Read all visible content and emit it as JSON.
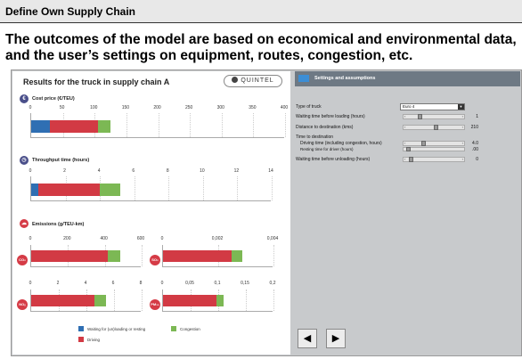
{
  "slide": {
    "title": "Define Own Supply Chain",
    "headline": "The outcomes of the model are based on economical and environmental data, and the user’s settings on equipment, routes, congestion, etc."
  },
  "results": {
    "title": "Results for the truck in supply chain A",
    "logo": "QUINTEL"
  },
  "colors": {
    "waiting": "#2f6fb3",
    "driving": "#d23a44",
    "congestion": "#7cb854",
    "icon_cost": "#4a4f8a",
    "icon_time": "#4a4f8a",
    "icon_emission": "#d53b46"
  },
  "sections": {
    "cost": {
      "label": "Cost price (€/TEU)",
      "icon": "€"
    },
    "time": {
      "label": "Throughput time (hours)",
      "icon": "◷"
    },
    "emissions": {
      "label": "Emissions (g/TEU-km)",
      "icon": "☁"
    }
  },
  "mini_icons": {
    "co2": "CO₂",
    "so2": "SO₂",
    "nox": "NOₓ",
    "pm": "PM₁₀"
  },
  "chart_data": [
    {
      "type": "bar",
      "name_key": "cost",
      "ticks": [
        "0",
        "50",
        "100",
        "150",
        "200",
        "250",
        "300",
        "350",
        "400"
      ],
      "xlim": [
        0,
        400
      ],
      "series": [
        {
          "name": "Waiting time (un)loading or resting",
          "value": 30
        },
        {
          "name": "Driving",
          "value": 75
        },
        {
          "name": "Congestion",
          "value": 20
        }
      ]
    },
    {
      "type": "bar",
      "name_key": "time",
      "ticks": [
        "0",
        "2",
        "4",
        "6",
        "8",
        "10",
        "12",
        "14"
      ],
      "xlim": [
        0,
        14
      ],
      "series": [
        {
          "name": "Waiting time (un)loading or resting",
          "value": 0.4
        },
        {
          "name": "Driving",
          "value": 3.6
        },
        {
          "name": "Congestion",
          "value": 1.2
        }
      ]
    },
    {
      "type": "bar",
      "name_key": "co2",
      "ticks": [
        "0",
        "200",
        "400",
        "600"
      ],
      "xlim": [
        0,
        600
      ],
      "series": [
        {
          "name": "Driving",
          "value": 415
        },
        {
          "name": "Congestion",
          "value": 70
        }
      ]
    },
    {
      "type": "bar",
      "name_key": "so2",
      "ticks": [
        "0",
        "0,002",
        "0,004"
      ],
      "xlim": [
        0,
        0.005
      ],
      "series": [
        {
          "name": "Driving",
          "value": 0.0031
        },
        {
          "name": "Congestion",
          "value": 0.0005
        }
      ]
    },
    {
      "type": "bar",
      "name_key": "nox",
      "ticks": [
        "0",
        "2",
        "4",
        "6",
        "8"
      ],
      "xlim": [
        0,
        8
      ],
      "series": [
        {
          "name": "Driving",
          "value": 4.6
        },
        {
          "name": "Congestion",
          "value": 0.8
        }
      ]
    },
    {
      "type": "bar",
      "name_key": "pm",
      "ticks": [
        "0",
        "0,05",
        "0,1",
        "0,15",
        "0,2"
      ],
      "xlim": [
        0,
        0.2
      ],
      "series": [
        {
          "name": "Driving",
          "value": 0.097
        },
        {
          "name": "Congestion",
          "value": 0.013
        }
      ]
    }
  ],
  "legend": {
    "waiting": "Waiting for (un)loading or resting",
    "driving": "Driving",
    "congestion": "Congestion"
  },
  "settings": {
    "title": "Settings and assumptions",
    "truck_type_label": "Type of truck",
    "truck_type_value": "Euro 4",
    "waiting_before_loading_label": "Waiting time before loading (hours)",
    "waiting_before_loading_value": "1",
    "distance_label": "Distance to destination (kms)",
    "distance_value": "210",
    "time_to_destination_label": "Time to destination",
    "driving_time_label": "Driving time (including congestion, hours)",
    "driving_time_value": "4.0",
    "resting_time_label": "Resting time for driver (hours)",
    "resting_time_value": ".00",
    "waiting_before_unloading_label": "Waiting time before unloading (hours)",
    "waiting_before_unloading_value": "0"
  },
  "nav": {
    "prev": "◀",
    "next": "▶"
  }
}
